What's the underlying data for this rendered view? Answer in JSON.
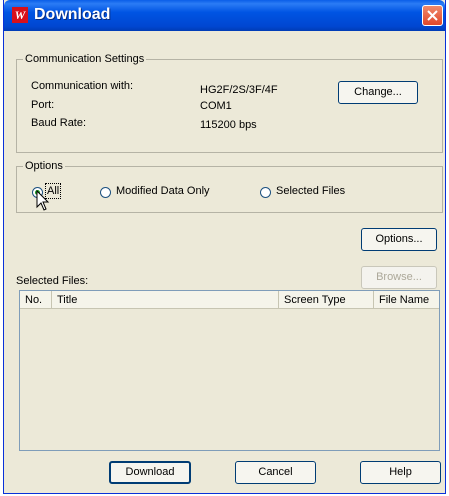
{
  "window": {
    "title": "Download",
    "app_icon_glyph": "W"
  },
  "communication": {
    "legend": "Communication Settings",
    "rows": [
      {
        "label": "Communication with:",
        "value": "HG2F/2S/3F/4F"
      },
      {
        "label": "Port:",
        "value": "COM1"
      },
      {
        "label": "Baud Rate:",
        "value": "115200 bps"
      }
    ],
    "change_label": "Change..."
  },
  "options": {
    "legend": "Options",
    "radios": [
      {
        "label": "All",
        "selected": true
      },
      {
        "label": "Modified Data Only",
        "selected": false
      },
      {
        "label": "Selected Files",
        "selected": false
      }
    ],
    "options_button": "Options..."
  },
  "selected_files": {
    "label": "Selected Files:",
    "browse_label": "Browse...",
    "columns": [
      "No.",
      "Title",
      "Screen Type",
      "File Name"
    ],
    "rows": []
  },
  "footer": {
    "download_label": "Download",
    "cancel_label": "Cancel",
    "help_label": "Help"
  },
  "colors": {
    "titlebar": "#0054e3",
    "dialog_bg": "#ece9d8",
    "close": "#e0462a",
    "radio_dot": "#1b9a20"
  }
}
